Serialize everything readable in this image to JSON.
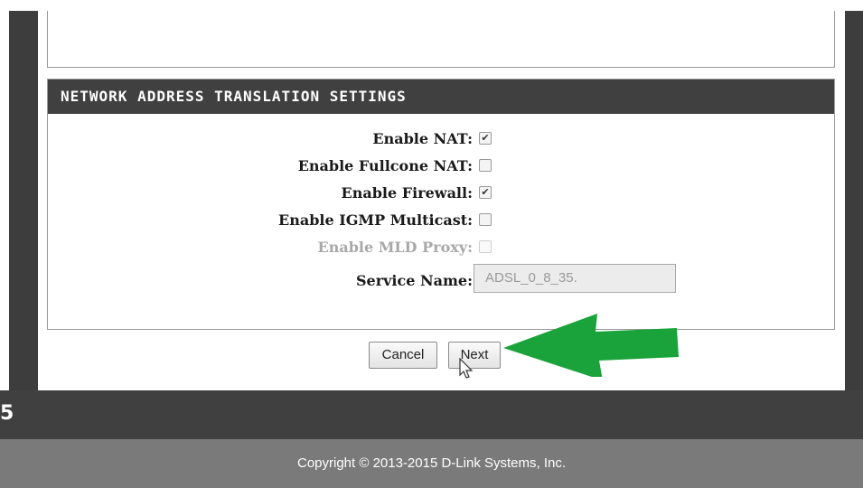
{
  "section": {
    "title": "NETWORK ADDRESS TRANSLATION SETTINGS"
  },
  "fields": [
    {
      "label": "Enable NAT:",
      "checked": true,
      "disabled": false
    },
    {
      "label": "Enable Fullcone NAT:",
      "checked": false,
      "disabled": false
    },
    {
      "label": "Enable Firewall:",
      "checked": true,
      "disabled": false
    },
    {
      "label": "Enable IGMP Multicast:",
      "checked": false,
      "disabled": false
    },
    {
      "label": "Enable MLD Proxy:",
      "checked": false,
      "disabled": true
    }
  ],
  "service": {
    "label": "Service Name:",
    "value": "ADSL_0_8_35."
  },
  "buttons": {
    "cancel": "Cancel",
    "next": "Next"
  },
  "footer": {
    "fragment": "5",
    "copyright": "Copyright © 2013-2015 D-Link Systems, Inc."
  },
  "colors": {
    "header_bg": "#404040",
    "arrow": "#1aa33a",
    "footer_gray": "#7a7a7a"
  },
  "icons": {
    "checkmark": "check-icon",
    "pointer": "mouse-pointer-icon",
    "annotation_arrow": "green-arrow-icon"
  }
}
